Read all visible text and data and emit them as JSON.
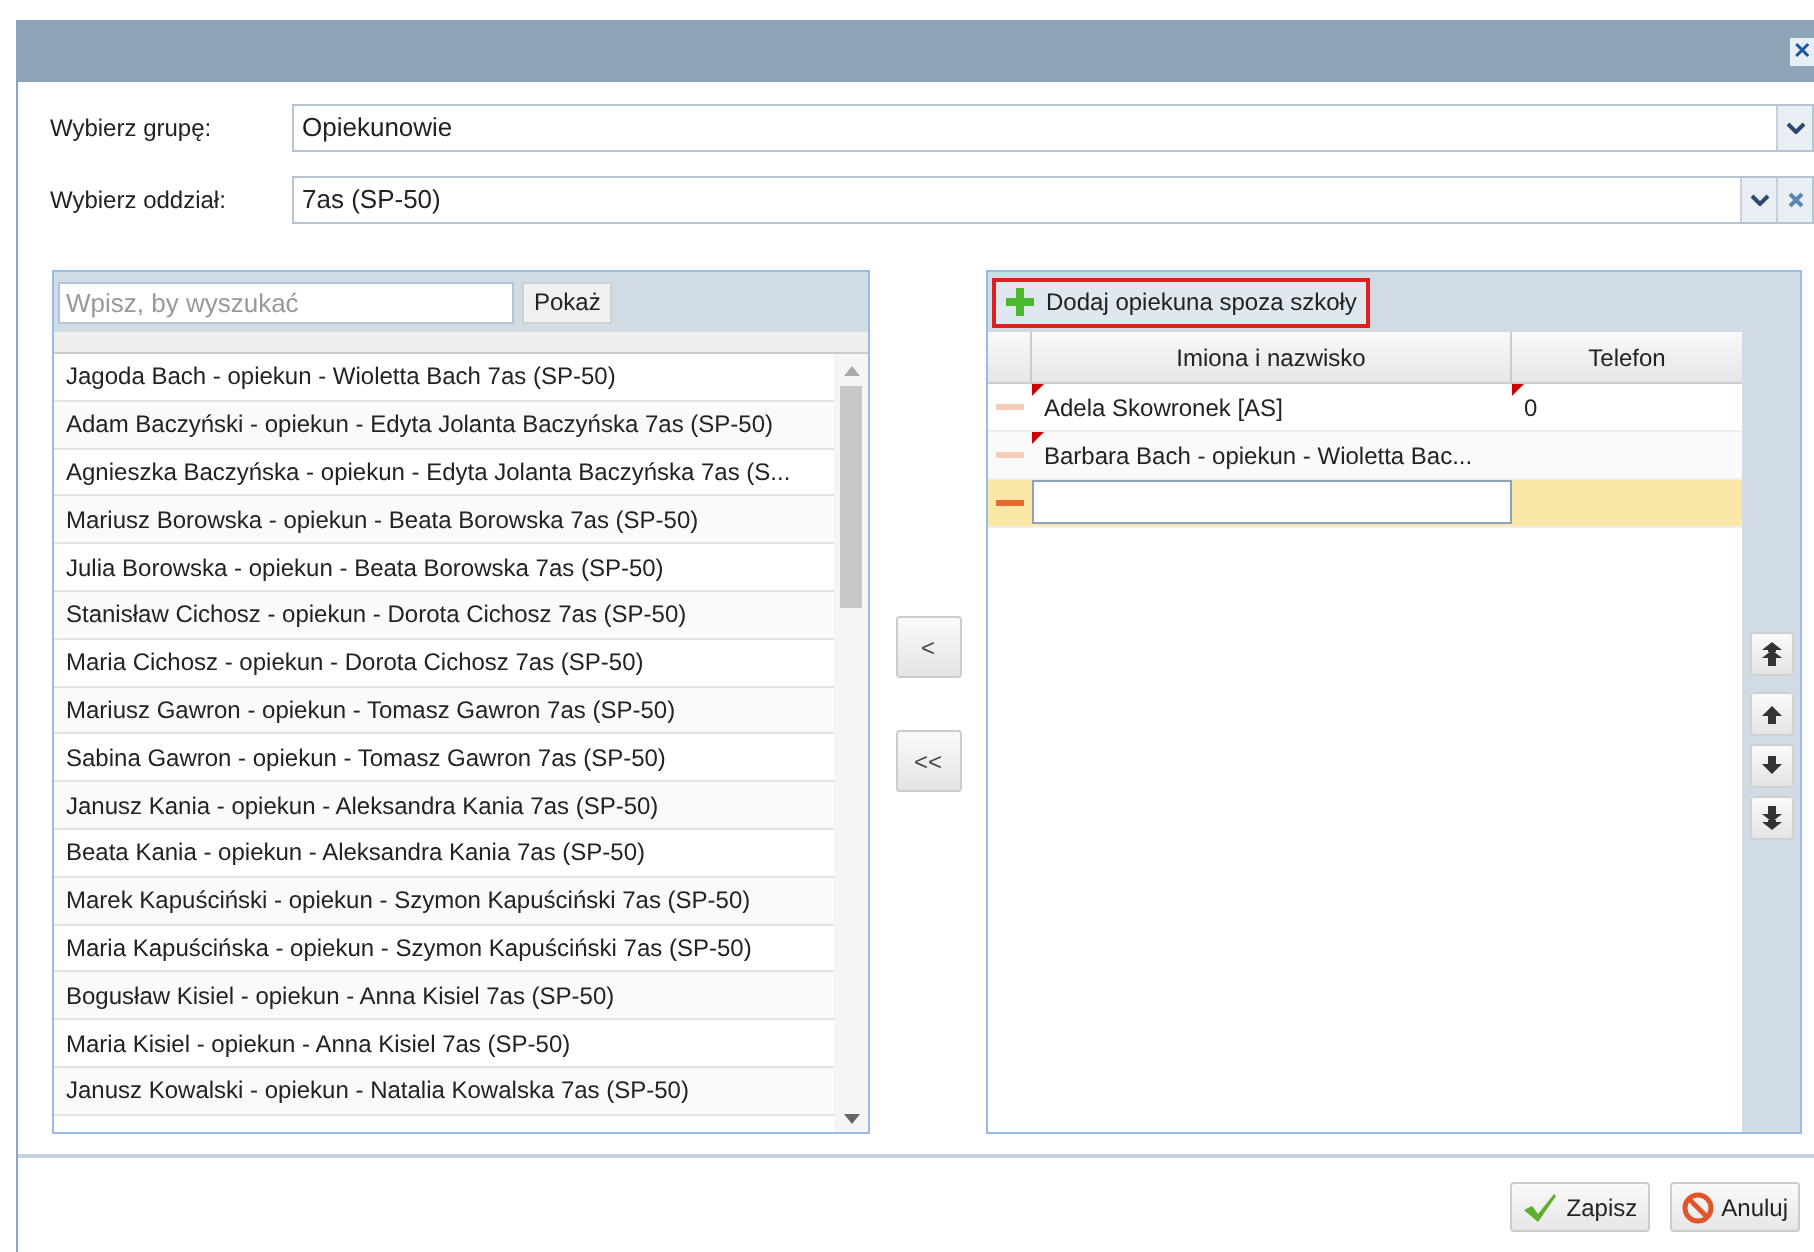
{
  "window": {
    "close": "✕"
  },
  "fields": [
    {
      "label": "Wybierz grupę:",
      "value": "Opiekunowie",
      "clearable": false
    },
    {
      "label": "Wybierz oddział:",
      "value": "7as (SP-50)",
      "clearable": true
    }
  ],
  "left_panel": {
    "search": {
      "placeholder": "Wpisz, by wyszukać"
    },
    "show_button": "Pokaż",
    "items": [
      "Jagoda Bach - opiekun - Wioletta Bach 7as (SP-50)",
      "Adam Baczyński - opiekun - Edyta Jolanta Baczyńska 7as (SP-50)",
      "Agnieszka Baczyńska - opiekun - Edyta Jolanta Baczyńska 7as (S...",
      "Mariusz Borowska - opiekun - Beata Borowska 7as (SP-50)",
      "Julia Borowska - opiekun - Beata Borowska 7as (SP-50)",
      "Stanisław Cichosz - opiekun - Dorota Cichosz 7as (SP-50)",
      "Maria Cichosz - opiekun - Dorota Cichosz 7as (SP-50)",
      "Mariusz Gawron - opiekun - Tomasz Gawron 7as (SP-50)",
      "Sabina Gawron - opiekun - Tomasz Gawron 7as (SP-50)",
      "Janusz Kania - opiekun - Aleksandra Kania 7as (SP-50)",
      "Beata Kania - opiekun - Aleksandra Kania 7as (SP-50)",
      "Marek Kapuściński - opiekun - Szymon Kapuściński 7as (SP-50)",
      "Maria Kapuścińska - opiekun - Szymon Kapuściński 7as (SP-50)",
      "Bogusław Kisiel - opiekun - Anna Kisiel 7as (SP-50)",
      "Maria Kisiel - opiekun - Anna Kisiel 7as (SP-50)",
      "Janusz Kowalski - opiekun - Natalia Kowalska 7as (SP-50)"
    ]
  },
  "move_buttons": [
    "<",
    "<<"
  ],
  "right_panel": {
    "add_button": "Dodaj opiekuna spoza szkoły",
    "columns": [
      "Imiona i nazwisko",
      "Telefon"
    ],
    "rows": [
      {
        "name": "Adela Skowronek [AS]",
        "phone": "0",
        "name_modified": true,
        "phone_modified": true,
        "selected": false,
        "editing": false
      },
      {
        "name": "Barbara Bach - opiekun - Wioletta Bac...",
        "name_modified": true,
        "phone_modified": false,
        "selected": false,
        "editing": false
      },
      {
        "name_modified": false,
        "phone_modified": false,
        "selected": true,
        "editing": true
      }
    ]
  },
  "footer": {
    "buttons": [
      {
        "kind": "save",
        "label": "Zapisz"
      },
      {
        "kind": "cancel",
        "label": "Anuluj"
      }
    ]
  }
}
